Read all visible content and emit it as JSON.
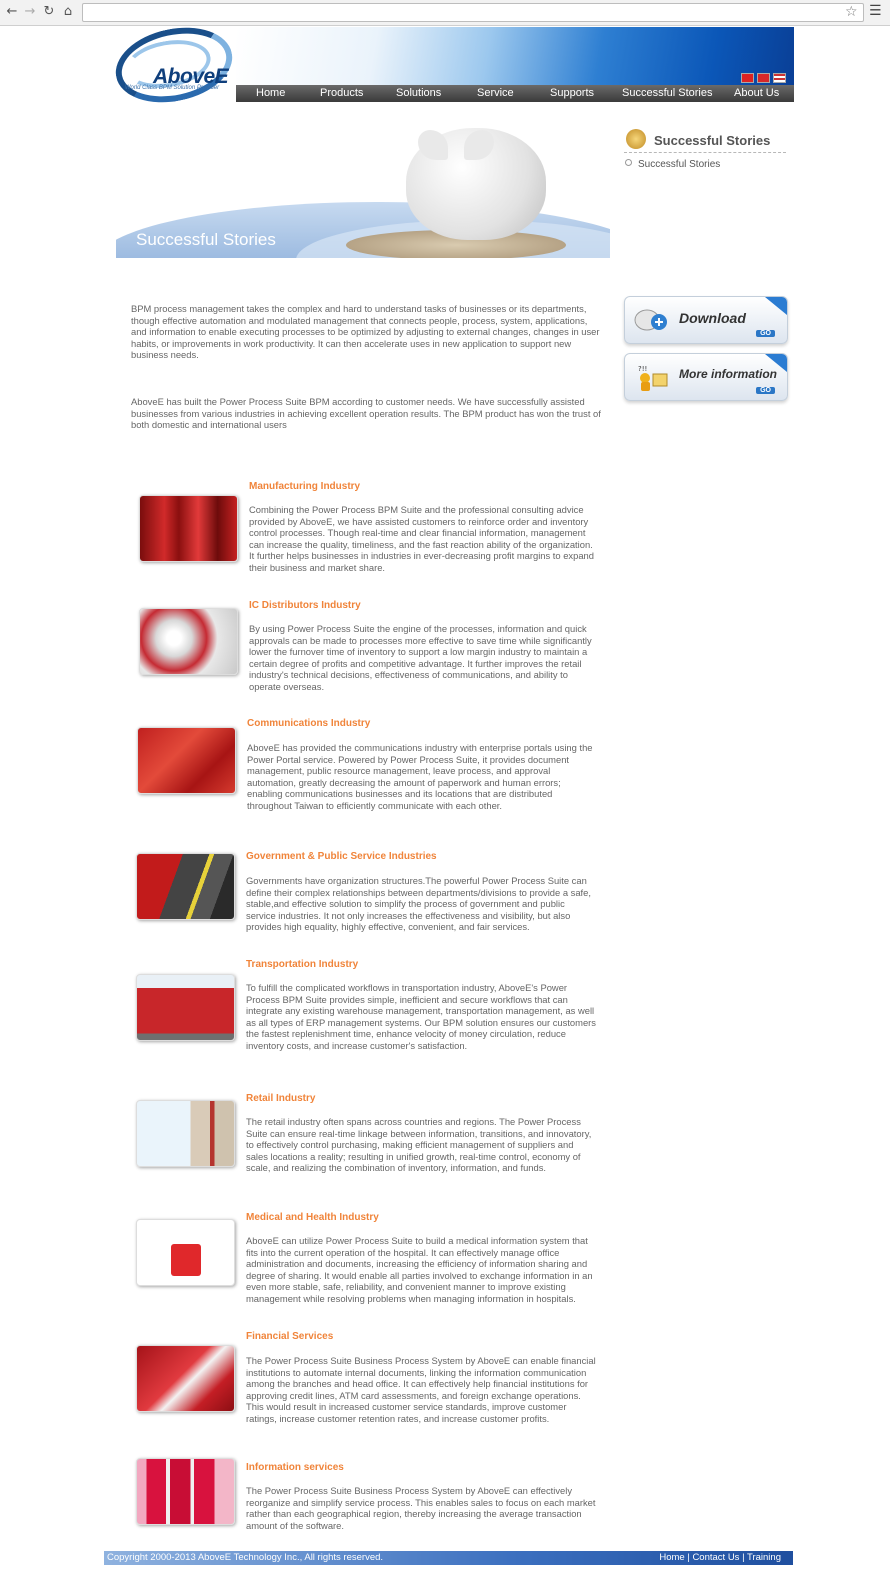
{
  "browser": {
    "back_icon": "arrow-left-icon",
    "forward_icon": "arrow-right-icon",
    "reload_icon": "reload-icon",
    "home_icon": "home-icon",
    "address": "",
    "star_icon": "star-icon",
    "menu_icon": "hamburger-icon"
  },
  "header": {
    "logo_text": "AboveE",
    "logo_tagline": "World Class BPM Solution Provider",
    "nav": [
      "Home",
      "Products",
      "Solutions",
      "Service",
      "Supports",
      "Successful Stories",
      "About Us"
    ]
  },
  "hero": {
    "title": "Successful Stories"
  },
  "sidebar": {
    "title": "Successful Stories",
    "links": [
      "Successful Stories"
    ],
    "download_label": "Download",
    "more_info_label": "More information",
    "go_label": "GO"
  },
  "intro": [
    "BPM process management takes the complex and hard to understand tasks of businesses or its departments, though effective automation and modulated management that connects people, process, system, applications, and information to enable executing processes to be optimized by adjusting to external changes, changes in user habits, or improvements in work productivity. It can then accelerate uses in new application to support new business needs.",
    "AboveE has built the Power Process Suite BPM according to customer needs. We have successfully assisted businesses from various industries in achieving excellent operation results. The BPM product has won the trust of both domestic and international users"
  ],
  "industries": [
    {
      "title": "Manufacturing Industry",
      "text": "Combining the Power Process BPM Suite and the professional consulting advice provided by AboveE, we have assisted customers to reinforce order and inventory control processes. Though real-time and clear financial information, management can increase the quality, timeliness, and the fast reaction ability of the organization. It further helps businesses in industries in ever-decreasing profit margins to expand their business and market share."
    },
    {
      "title": "IC Distributors Industry",
      "text": "By using Power Process Suite the engine of the processes, information and quick approvals can be made to processes more effective to save time while significantly lower the furnover time of inventory to support a low margin industry to maintain a certain degree of profits and competitive advantage. It further improves the retail industry's technical decisions, effectiveness of communications, and ability to operate overseas."
    },
    {
      "title": "Communications Industry",
      "text": "AboveE has provided the communications industry with enterprise portals using the Power Portal service. Powered by Power Process Suite, it provides document management, public resource management, leave process, and approval automation, greatly decreasing the amount of paperwork and human errors; enabling communications businesses and its locations that are distributed throughout Taiwan to efficiently communicate with each other."
    },
    {
      "title": "Government & Public Service Industries",
      "text": "Governments have organization structures.The powerful Power Process Suite can define their complex relationships between departments/divisions to provide a safe, stable,and effective solution to simplify the process of government and public service industries. It not only increases the effectiveness and visibility, but also provides high equality, highly effective, convenient, and fair services."
    },
    {
      "title": "Transportation Industry",
      "text": "To fulfill the complicated workflows in transportation industry, AboveE's Power Process BPM Suite provides simple, inefficient and secure workflows that can integrate any existing warehouse management, transportation management, as well as all types of ERP management systems. Our BPM solution ensures our customers the fastest replenishment time, enhance velocity of money circulation, reduce inventory costs, and increase customer's satisfaction."
    },
    {
      "title": "Retail Industry",
      "text": "The retail industry often spans across countries and regions. The Power Process Suite can ensure real-time linkage between information, transitions, and innovatory, to effectively control purchasing, making efficient management of suppliers and sales locations a reality; resulting in unified growth, real-time control, economy of scale, and realizing the combination of inventory, information, and funds."
    },
    {
      "title": "Medical and Health Industry",
      "text": "AboveE can utilize Power Process Suite to build a medical information system that fits into the current operation of the hospital. It can effectively manage office administration and documents, increasing the efficiency of information sharing and degree of sharing. It would enable all parties involved to exchange information in an even more stable, safe, reliability, and convenient manner to improve existing management while resolving problems when managing information in hospitals."
    },
    {
      "title": "Financial Services",
      "text": "The Power Process Suite Business Process System by AboveE can enable financial institutions to automate internal documents, linking the information communication among the branches and head office. It can effectively help financial institutions for approving credit lines, ATM card assessments, and foreign exchange operations. This would result in increased customer service standards, improve customer ratings, increase customer retention rates, and increase customer profits."
    },
    {
      "title": "Information services",
      "text": "The Power Process Suite Business Process System by AboveE can effectively reorganize and simplify service process. This enables sales to focus on each market rather than each geographical region, thereby increasing the average transaction amount of the software."
    }
  ],
  "footer": {
    "copyright": "Copyright 2000-2013 AboveE Technology Inc., All rights reserved.",
    "links": [
      "Home",
      "Contact Us",
      "Training"
    ],
    "separator": "|"
  }
}
